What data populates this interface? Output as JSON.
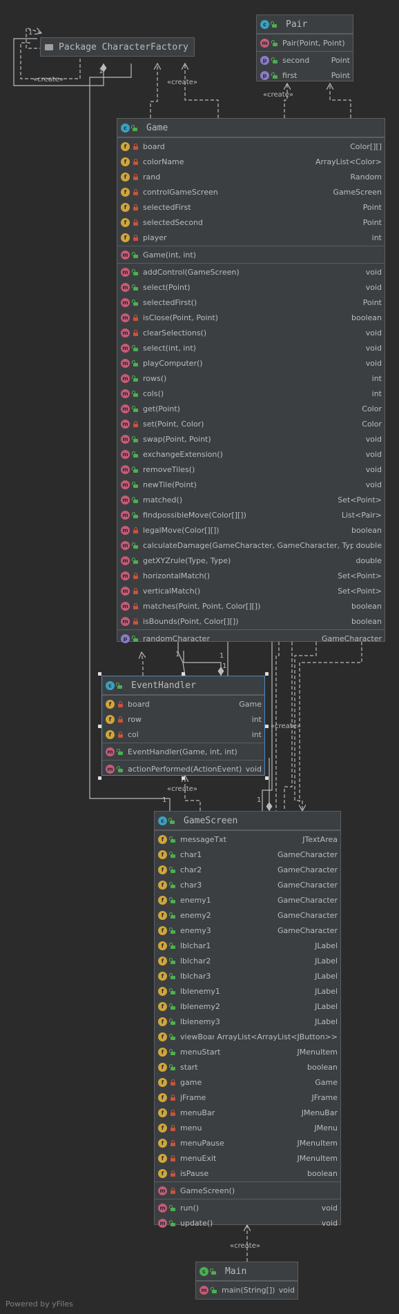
{
  "package": {
    "label": "Package CharacterFactory"
  },
  "pair": {
    "title": "Pair",
    "constructor": {
      "name": "Pair(Point, Point)"
    },
    "properties": [
      {
        "name": "second",
        "type": "Point"
      },
      {
        "name": "first",
        "type": "Point"
      }
    ]
  },
  "game": {
    "title": "Game",
    "fields": [
      {
        "name": "board",
        "type": "Color[][]"
      },
      {
        "name": "colorName",
        "type": "ArrayList<Color>"
      },
      {
        "name": "rand",
        "type": "Random"
      },
      {
        "name": "controlGameScreen",
        "type": "GameScreen"
      },
      {
        "name": "selectedFirst",
        "type": "Point"
      },
      {
        "name": "selectedSecond",
        "type": "Point"
      },
      {
        "name": "player",
        "type": "int"
      }
    ],
    "constructor": {
      "name": "Game(int, int)"
    },
    "methods": [
      {
        "name": "addControl(GameScreen)",
        "type": "void",
        "vis": "open"
      },
      {
        "name": "select(Point)",
        "type": "void",
        "vis": "open"
      },
      {
        "name": "selectedFirst()",
        "type": "Point",
        "vis": "open"
      },
      {
        "name": "isClose(Point, Point)",
        "type": "boolean",
        "vis": "lock"
      },
      {
        "name": "clearSelections()",
        "type": "void",
        "vis": "lock"
      },
      {
        "name": "select(int, int)",
        "type": "void",
        "vis": "open"
      },
      {
        "name": "playComputer()",
        "type": "void",
        "vis": "open"
      },
      {
        "name": "rows()",
        "type": "int",
        "vis": "open"
      },
      {
        "name": "cols()",
        "type": "int",
        "vis": "open"
      },
      {
        "name": "get(Point)",
        "type": "Color",
        "vis": "open"
      },
      {
        "name": "set(Point, Color)",
        "type": "Color",
        "vis": "lock"
      },
      {
        "name": "swap(Point, Point)",
        "type": "void",
        "vis": "open"
      },
      {
        "name": "exchangeExtension()",
        "type": "void",
        "vis": "open"
      },
      {
        "name": "removeTiles()",
        "type": "void",
        "vis": "open"
      },
      {
        "name": "newTile(Point)",
        "type": "void",
        "vis": "open"
      },
      {
        "name": "matched()",
        "type": "Set<Point>",
        "vis": "open"
      },
      {
        "name": "findpossibleMove(Color[][])",
        "type": "List<Pair>",
        "vis": "open"
      },
      {
        "name": "legalMove(Color[][])",
        "type": "boolean",
        "vis": "lock"
      },
      {
        "name": "calculateDamage(GameCharacter, GameCharacter, Type)",
        "type": "double",
        "vis": "open"
      },
      {
        "name": "getXYZrule(Type, Type)",
        "type": "double",
        "vis": "open"
      },
      {
        "name": "horizontalMatch()",
        "type": "Set<Point>",
        "vis": "lock"
      },
      {
        "name": "verticalMatch()",
        "type": "Set<Point>",
        "vis": "lock"
      },
      {
        "name": "matches(Point, Point, Color[][])",
        "type": "boolean",
        "vis": "lock"
      },
      {
        "name": "isBounds(Point, Color[][])",
        "type": "boolean",
        "vis": "lock"
      }
    ],
    "properties": [
      {
        "name": "randomCharacter",
        "type": "GameCharacter"
      }
    ]
  },
  "eventHandler": {
    "title": "EventHandler",
    "fields": [
      {
        "name": "board",
        "type": "Game"
      },
      {
        "name": "row",
        "type": "int"
      },
      {
        "name": "col",
        "type": "int"
      }
    ],
    "constructor": {
      "name": "EventHandler(Game, int, int)"
    },
    "methods": [
      {
        "name": "actionPerformed(ActionEvent)",
        "type": "void",
        "vis": "open"
      }
    ]
  },
  "gameScreen": {
    "title": "GameScreen",
    "fields": [
      {
        "name": "messageTxt",
        "type": "JTextArea",
        "vis": "open"
      },
      {
        "name": "char1",
        "type": "GameCharacter",
        "vis": "open"
      },
      {
        "name": "char2",
        "type": "GameCharacter",
        "vis": "open"
      },
      {
        "name": "char3",
        "type": "GameCharacter",
        "vis": "open"
      },
      {
        "name": "enemy1",
        "type": "GameCharacter",
        "vis": "open"
      },
      {
        "name": "enemy2",
        "type": "GameCharacter",
        "vis": "open"
      },
      {
        "name": "enemy3",
        "type": "GameCharacter",
        "vis": "open"
      },
      {
        "name": "lblchar1",
        "type": "JLabel",
        "vis": "open"
      },
      {
        "name": "lblchar2",
        "type": "JLabel",
        "vis": "open"
      },
      {
        "name": "lblchar3",
        "type": "JLabel",
        "vis": "open"
      },
      {
        "name": "lblenemy1",
        "type": "JLabel",
        "vis": "open"
      },
      {
        "name": "lblenemy2",
        "type": "JLabel",
        "vis": "open"
      },
      {
        "name": "lblenemy3",
        "type": "JLabel",
        "vis": "open"
      },
      {
        "name": "viewBoard",
        "type": "ArrayList<ArrayList<JButton>>",
        "vis": "open"
      },
      {
        "name": "menuStart",
        "type": "JMenuItem",
        "vis": "open"
      },
      {
        "name": "start",
        "type": "boolean",
        "vis": "open"
      },
      {
        "name": "game",
        "type": "Game",
        "vis": "lock"
      },
      {
        "name": "jFrame",
        "type": "JFrame",
        "vis": "lock"
      },
      {
        "name": "menuBar",
        "type": "JMenuBar",
        "vis": "lock"
      },
      {
        "name": "menu",
        "type": "JMenu",
        "vis": "lock"
      },
      {
        "name": "menuPause",
        "type": "JMenuItem",
        "vis": "lock"
      },
      {
        "name": "menuExit",
        "type": "JMenuItem",
        "vis": "lock"
      },
      {
        "name": "isPause",
        "type": "boolean",
        "vis": "lock"
      }
    ],
    "constructor": {
      "name": "GameScreen()"
    },
    "methods": [
      {
        "name": "run()",
        "type": "void",
        "vis": "open"
      },
      {
        "name": "update()",
        "type": "void",
        "vis": "open"
      }
    ]
  },
  "main": {
    "title": "Main",
    "methods": [
      {
        "name": "main(String[])",
        "type": "void",
        "vis": "open"
      }
    ]
  },
  "edge_labels": {
    "create": "«create»",
    "mult_pkg_self": "1",
    "mult_pkg_game": "1",
    "mult_game_eh": "1",
    "mult_game_eh2": "1",
    "mult_eh_game": "1",
    "mult_gs_1": "1",
    "mult_gs_2": "1"
  },
  "footer": "Powered by yFiles"
}
